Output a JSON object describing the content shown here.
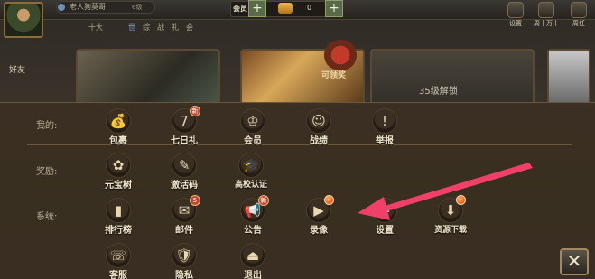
{
  "top": {
    "player_name": "老人狗莫哥",
    "player_level": "6级",
    "vip_label": "会员",
    "gold_value": "0",
    "plus_symbol": "+",
    "top_right_buttons": [
      {
        "label": "设置"
      },
      {
        "label": "周十万十"
      },
      {
        "label": "周任"
      }
    ],
    "left_nav": {
      "label": "好友"
    },
    "sub_tabs": [
      "十大",
      "世",
      "综",
      "战",
      "礼",
      "会"
    ]
  },
  "banner": {
    "gift_label": "可领奖",
    "locked_label": "35级解锁"
  },
  "panel": {
    "sections": [
      {
        "label": "我的:"
      },
      {
        "label": "奖励:"
      },
      {
        "label": "系统:"
      }
    ],
    "mine": [
      {
        "label": "包裹",
        "glyph": "💰"
      },
      {
        "label": "七日礼",
        "glyph": "7",
        "badge": "新"
      },
      {
        "label": "会员",
        "glyph": "♔"
      },
      {
        "label": "战绩",
        "glyph": "☺"
      },
      {
        "label": "举报",
        "glyph": "!"
      }
    ],
    "rewards": [
      {
        "label": "元宝树",
        "glyph": "✿"
      },
      {
        "label": "激活码",
        "glyph": "✎"
      },
      {
        "label": "高校认证",
        "glyph": "🎓"
      }
    ],
    "system_row1": [
      {
        "label": "排行榜",
        "glyph": "▮"
      },
      {
        "label": "邮件",
        "glyph": "✉",
        "badge": "5"
      },
      {
        "label": "公告",
        "glyph": "📢",
        "badge": "新"
      },
      {
        "label": "录像",
        "glyph": "▶",
        "dot": true
      },
      {
        "label": "设置",
        "glyph": "⚙"
      },
      {
        "label": "资源下载",
        "glyph": "⬇",
        "dot": true
      }
    ],
    "system_row2": [
      {
        "label": "客服",
        "glyph": "☏"
      },
      {
        "label": "隐私",
        "glyph": "🛡"
      },
      {
        "label": "退出",
        "glyph": "⏏"
      }
    ],
    "close_symbol": "✕"
  },
  "colors": {
    "panel_bg": "#3a2f21",
    "label_text": "#f1e6cc",
    "section_text": "#b9ae98",
    "badge_red": "#c0462c",
    "arrow": "#f0406a"
  }
}
